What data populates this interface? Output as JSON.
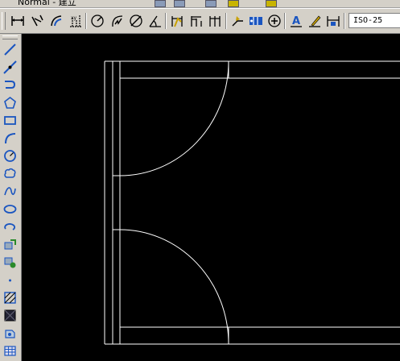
{
  "top_strip": {
    "layer_label": "Normal - 建立"
  },
  "dim_toolbar": {
    "buttons": [
      "linear-dimension-icon",
      "aligned-dimension-icon",
      "arc-length-icon",
      "ordinate-dimension-icon",
      "radius-dimension-icon",
      "jogged-dimension-icon",
      "diameter-dimension-icon",
      "angular-dimension-icon",
      "quick-dimension-icon",
      "baseline-dimension-icon",
      "continue-dimension-icon",
      "quick-leader-icon",
      "tolerance-icon",
      "center-mark-icon",
      "dimension-edit-icon",
      "dimension-text-edit-icon",
      "dimension-update-icon"
    ],
    "dim_style": "ISO-25"
  },
  "draw_toolbar": {
    "tools": [
      "line-icon",
      "construction-line-icon",
      "polyline-icon",
      "polygon-icon",
      "rectangle-icon",
      "arc-icon",
      "circle-icon",
      "revision-cloud-icon",
      "spline-icon",
      "ellipse-icon",
      "ellipse-arc-icon",
      "insert-block-icon",
      "make-block-icon",
      "point-icon",
      "hatch-icon",
      "gradient-icon",
      "region-icon",
      "table-icon"
    ]
  },
  "drawing": {
    "description_entities": "door-plan-lines",
    "stroke_color": "#ffffff",
    "background": "#000000"
  }
}
